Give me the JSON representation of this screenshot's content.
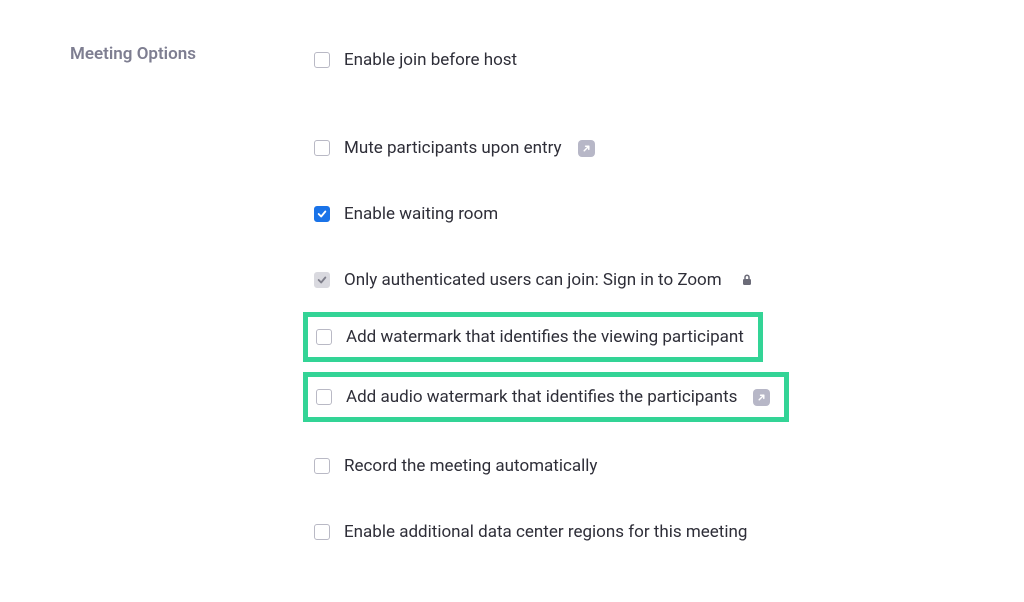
{
  "section_title": "Meeting Options",
  "options": {
    "join_before_host": {
      "label": "Enable join before host"
    },
    "mute_on_entry": {
      "label": "Mute participants upon entry"
    },
    "waiting_room": {
      "label": "Enable waiting room"
    },
    "auth_users": {
      "label": "Only authenticated users can join: Sign in to Zoom"
    },
    "watermark": {
      "label": "Add watermark that identifies the viewing participant"
    },
    "audio_watermark": {
      "label": "Add audio watermark that identifies the participants"
    },
    "record_auto": {
      "label": "Record the meeting automatically"
    },
    "data_center": {
      "label": "Enable additional data center regions for this meeting"
    }
  }
}
